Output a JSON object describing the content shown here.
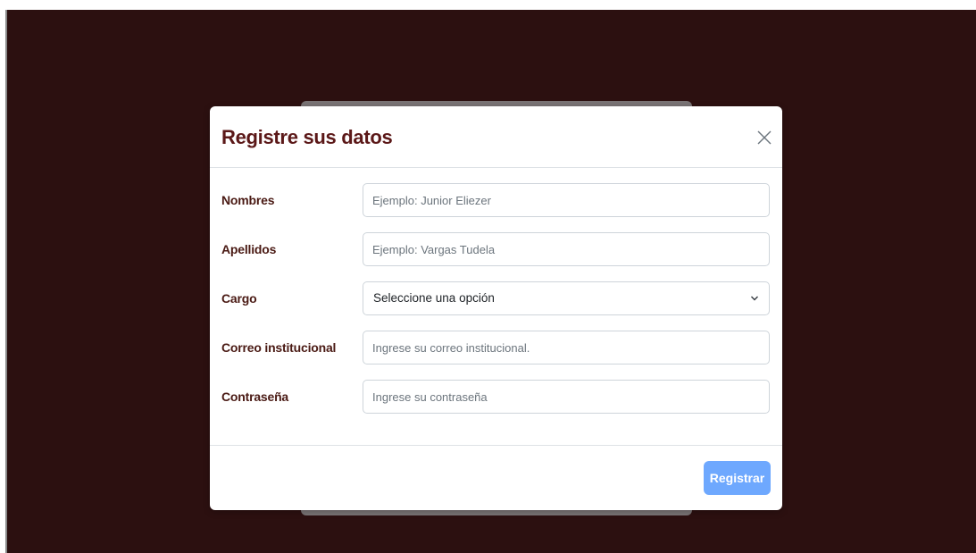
{
  "modal": {
    "title": "Registre sus datos",
    "close_icon": "close-icon",
    "fields": [
      {
        "label": "Nombres",
        "placeholder": "Ejemplo: Junior Eliezer",
        "value": ""
      },
      {
        "label": "Apellidos",
        "placeholder": "Ejemplo: Vargas Tudela",
        "value": ""
      },
      {
        "label": "Cargo",
        "selected": "Seleccione una opción",
        "icon": "chevron-down-icon"
      },
      {
        "label": "Correo institucional",
        "placeholder": "Ingrese su correo institucional.",
        "value": ""
      },
      {
        "label": "Contraseña",
        "placeholder": "Ingrese su contraseña",
        "value": ""
      }
    ],
    "footer": {
      "submit_label": "Registrar"
    }
  },
  "colors": {
    "backdrop": "#2c1010",
    "title": "#5b1818",
    "label": "#4a1a14",
    "button": "#6ea8fe"
  }
}
